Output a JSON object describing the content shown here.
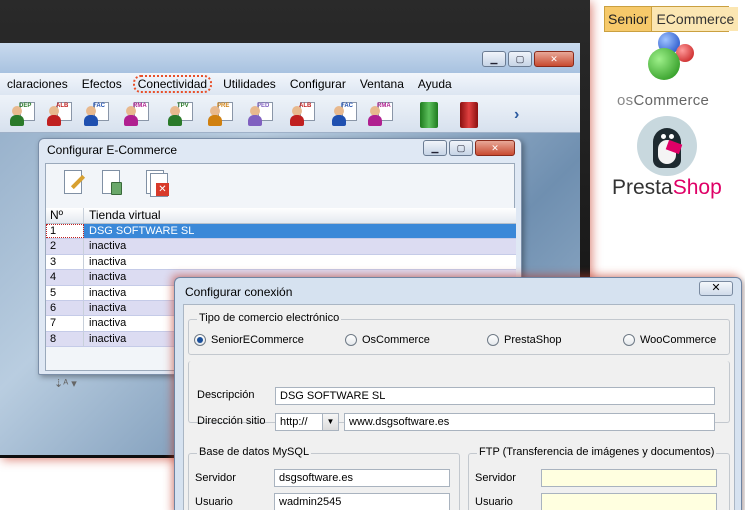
{
  "main_window": {
    "menu": [
      "claraciones",
      "Efectos",
      "Conectividad",
      "Utilidades",
      "Configurar",
      "Ventana",
      "Ayuda"
    ],
    "toolbar_icons": [
      {
        "label": "DEP",
        "color": "#2a7a2a",
        "icon": "user-doc-icon"
      },
      {
        "label": "ALB",
        "color": "#c02020",
        "icon": "user-doc-icon"
      },
      {
        "label": "FAC",
        "color": "#2050b0",
        "icon": "user-doc-icon"
      },
      {
        "label": "RMA",
        "color": "#b02090",
        "icon": "user-doc-icon"
      },
      {
        "label": "TPV",
        "color": "#2a7a2a",
        "icon": "user-doc-icon"
      },
      {
        "label": "PRE",
        "color": "#d08010",
        "icon": "user-doc-icon"
      },
      {
        "label": "PED",
        "color": "#8060c0",
        "icon": "user-doc-icon"
      },
      {
        "label": "ALB",
        "color": "#c02020",
        "icon": "user-doc-icon"
      },
      {
        "label": "FAC",
        "color": "#2050b0",
        "icon": "user-doc-icon"
      },
      {
        "label": "RMA",
        "color": "#b02090",
        "icon": "user-doc-icon"
      }
    ]
  },
  "ecommerce_window": {
    "title": "Configurar E-Commerce",
    "columns": [
      "Nº",
      "Tienda virtual"
    ],
    "rows": [
      {
        "n": "1",
        "store": "DSG SOFTWARE SL"
      },
      {
        "n": "2",
        "store": "inactiva"
      },
      {
        "n": "3",
        "store": "inactiva"
      },
      {
        "n": "4",
        "store": "inactiva"
      },
      {
        "n": "5",
        "store": "inactiva"
      },
      {
        "n": "6",
        "store": "inactiva"
      },
      {
        "n": "7",
        "store": "inactiva"
      },
      {
        "n": "8",
        "store": "inactiva"
      }
    ]
  },
  "connection_dialog": {
    "title": "Configurar conexión",
    "type_group": "Tipo de comercio electrónico",
    "types": [
      "SeniorECommerce",
      "OsCommerce",
      "PrestaShop",
      "WooCommerce"
    ],
    "selected_type": "SeniorECommerce",
    "descripcion_label": "Descripción",
    "descripcion_value": "DSG SOFTWARE SL",
    "direccion_label": "Dirección sitio",
    "protocol_value": "http://",
    "url_value": "www.dsgsoftware.es",
    "db_group": "Base de datos MySQL",
    "ftp_group": "FTP (Transferencia de imágenes y documentos)",
    "servidor_label": "Servidor",
    "usuario_label": "Usuario",
    "db_server_value": "dsgsoftware.es",
    "db_user_value": "wadmin2545"
  },
  "logos": {
    "senior_a": "Senior",
    "senior_b": "ECommerce",
    "oscommerce_os": "os",
    "oscommerce_rest": "Commerce",
    "presta_a": "Presta",
    "presta_b": "Shop"
  }
}
